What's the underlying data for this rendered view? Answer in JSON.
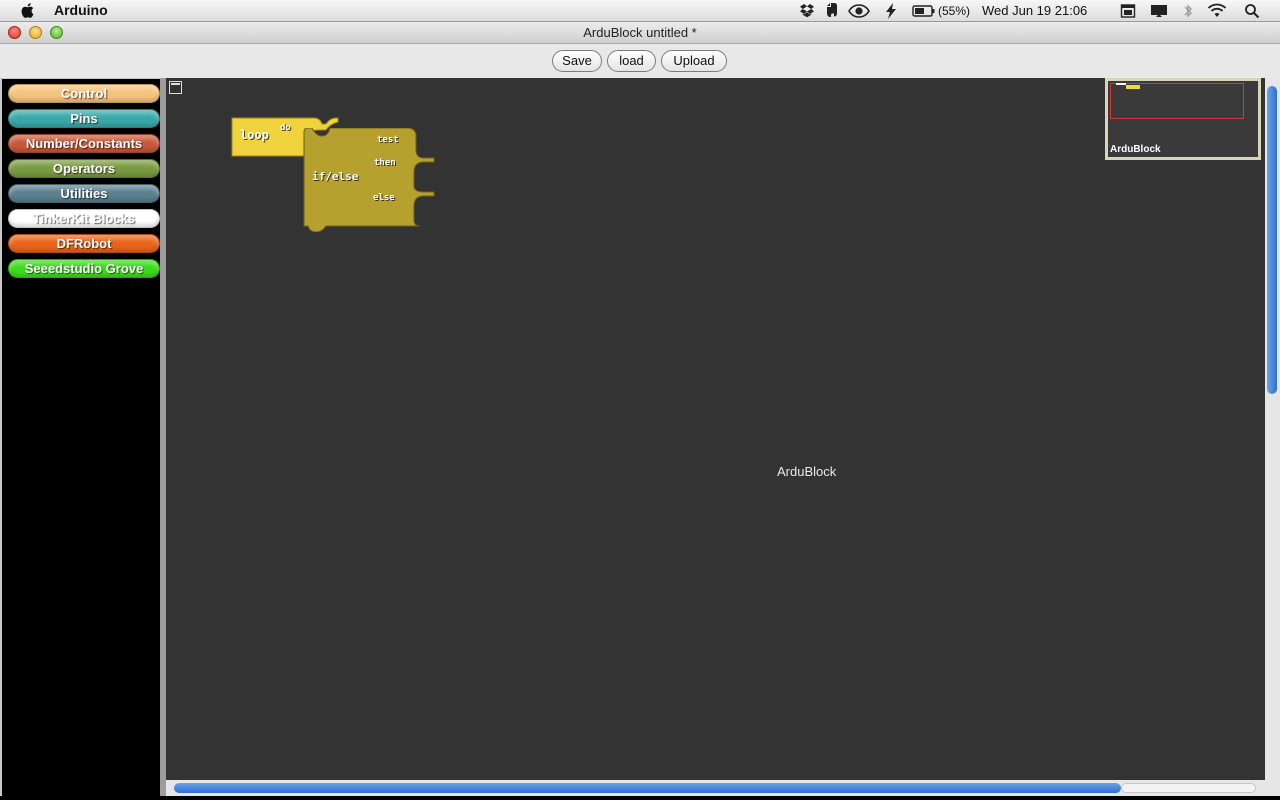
{
  "menubar": {
    "app_name": "Arduino",
    "battery": "(55%)",
    "clock": "Wed Jun 19  21:06"
  },
  "window": {
    "title": "ArduBlock untitled *"
  },
  "toolbar": {
    "save_label": "Save",
    "load_label": "load",
    "upload_label": "Upload"
  },
  "palette": {
    "categories": [
      {
        "label": "Control",
        "color": "#f5c47c"
      },
      {
        "label": "Pins",
        "color": "#3aa8a8"
      },
      {
        "label": "Number/Constants",
        "color": "#c8583a"
      },
      {
        "label": "Operators",
        "color": "#7a9a40"
      },
      {
        "label": "Utilities",
        "color": "#5a7f8e"
      },
      {
        "label": "TinkerKit Blocks",
        "color": "#ffffff"
      },
      {
        "label": "DFRobot",
        "color": "#e8641c"
      },
      {
        "label": "Seeedstudio Grove",
        "color": "#3cdc1c"
      }
    ]
  },
  "canvas": {
    "watermark": "ArduBlock",
    "background": "#333333",
    "blocks": {
      "loop": {
        "label": "loop",
        "socket": "do",
        "color": "#f0d23c"
      },
      "ifelse": {
        "label": "if/else",
        "sockets": [
          "test",
          "then",
          "else"
        ],
        "color": "#b7a12e"
      }
    }
  },
  "minimap": {
    "label": "ArduBlock"
  },
  "icons": [
    "apple-icon",
    "dropbox-icon",
    "evernote-icon",
    "eye-icon",
    "bolt-icon",
    "battery-icon",
    "calendar-icon",
    "display-icon",
    "bluetooth-icon",
    "wifi-icon",
    "search-icon"
  ]
}
